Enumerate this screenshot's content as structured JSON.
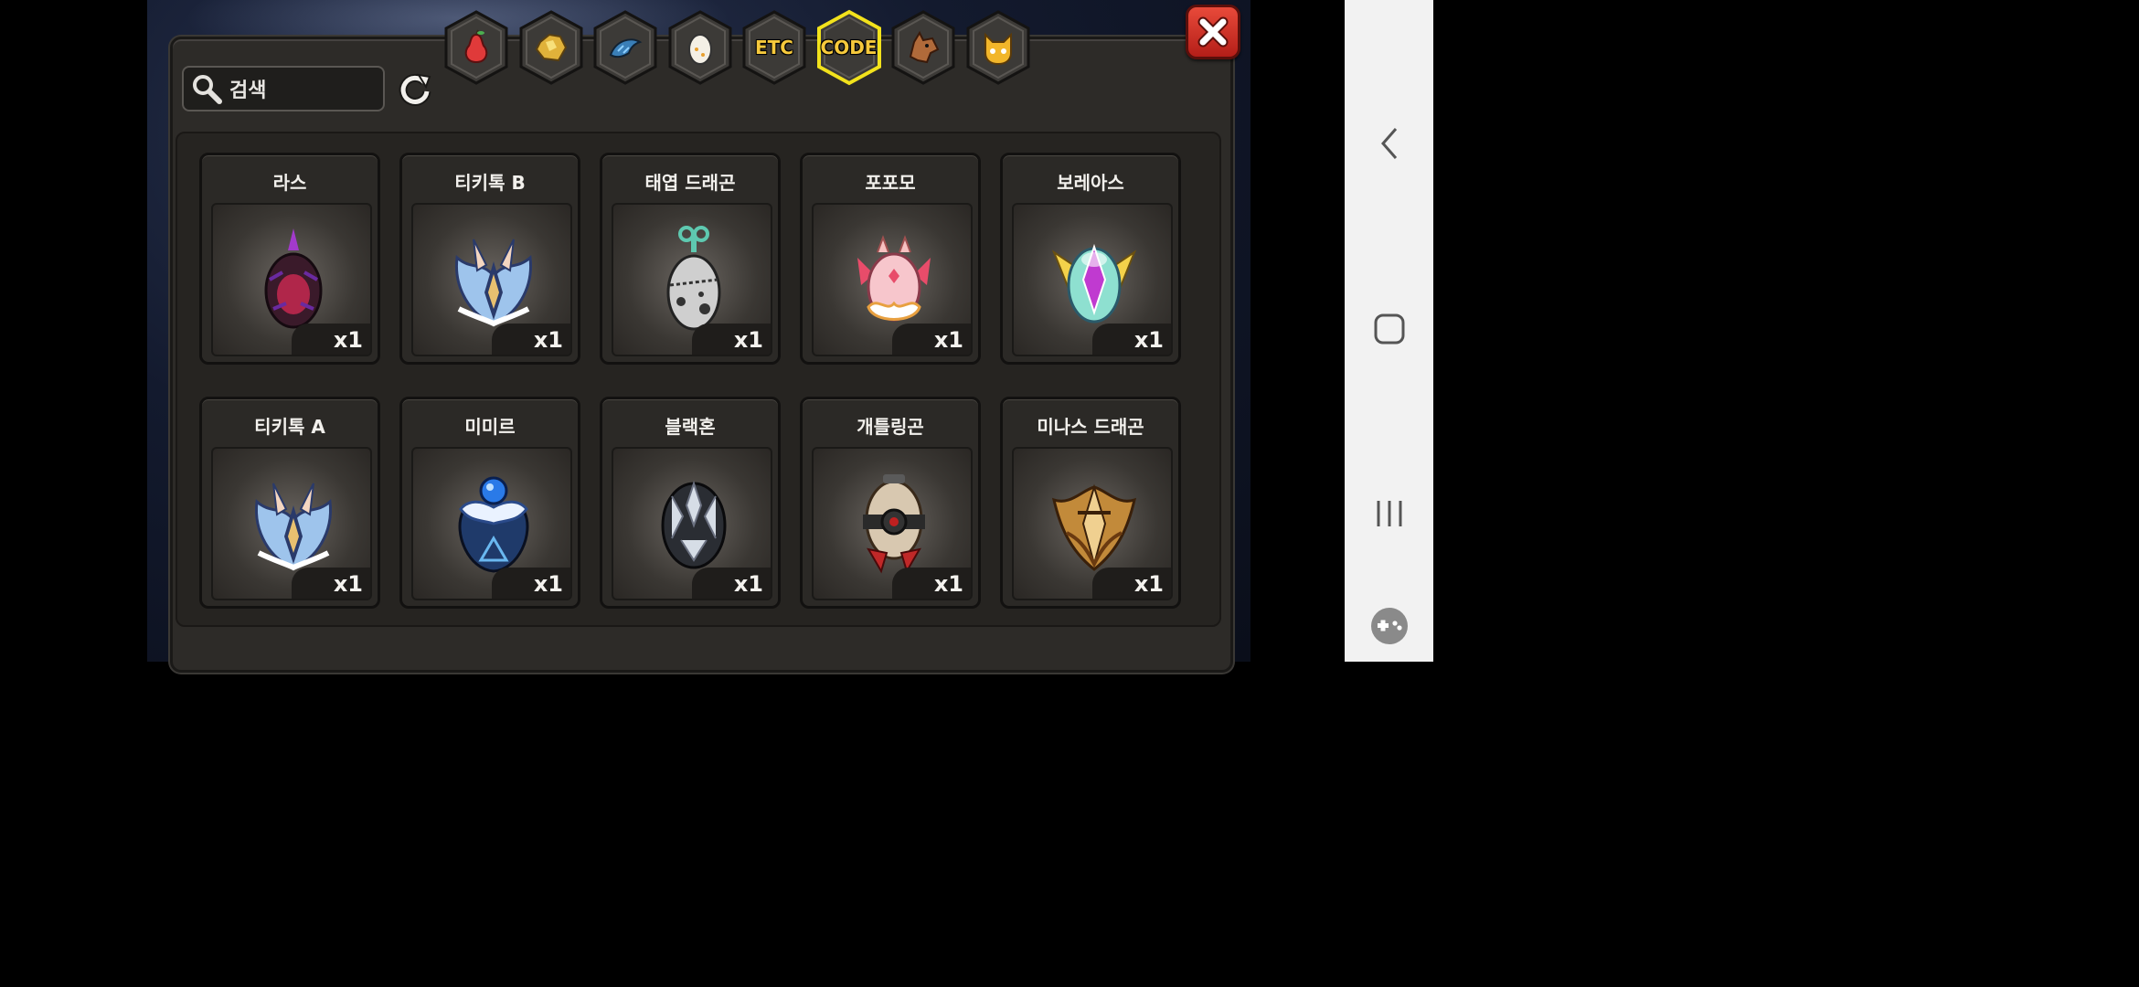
{
  "search": {
    "placeholder": "검색"
  },
  "tabs": [
    {
      "icon": "pear-icon",
      "label": "",
      "selected": false
    },
    {
      "icon": "gold-ore-icon",
      "label": "",
      "selected": false
    },
    {
      "icon": "dragon-scale-icon",
      "label": "",
      "selected": false
    },
    {
      "icon": "egg-icon",
      "label": "",
      "selected": false
    },
    {
      "icon": "",
      "label": "ETC",
      "selected": false
    },
    {
      "icon": "",
      "label": "CODE",
      "selected": true
    },
    {
      "icon": "dragon-head-icon",
      "label": "",
      "selected": false
    },
    {
      "icon": "cat-mask-icon",
      "label": "",
      "selected": false
    }
  ],
  "items": [
    {
      "name": "라스",
      "qty": "x1",
      "egg": "dark-purple-egg"
    },
    {
      "name": "티키톡 B",
      "qty": "x1",
      "egg": "blue-winged-egg"
    },
    {
      "name": "태엽 드래곤",
      "qty": "x1",
      "egg": "windup-egg"
    },
    {
      "name": "포포모",
      "qty": "x1",
      "egg": "pink-fluffy-egg"
    },
    {
      "name": "보레아스",
      "qty": "x1",
      "egg": "crystal-winged-egg"
    },
    {
      "name": "티키톡 A",
      "qty": "x1",
      "egg": "blue-winged-egg"
    },
    {
      "name": "미미르",
      "qty": "x1",
      "egg": "orb-egg"
    },
    {
      "name": "블랙혼",
      "qty": "x1",
      "egg": "black-horn-egg"
    },
    {
      "name": "개틀링곤",
      "qty": "x1",
      "egg": "gatling-egg"
    },
    {
      "name": "미나스 드래곤",
      "qty": "x1",
      "egg": "golden-helm-egg"
    }
  ],
  "colors": {
    "selected_tab": "#f2e21c",
    "tab_label": "#f6c93c",
    "close": "#d6302a"
  }
}
